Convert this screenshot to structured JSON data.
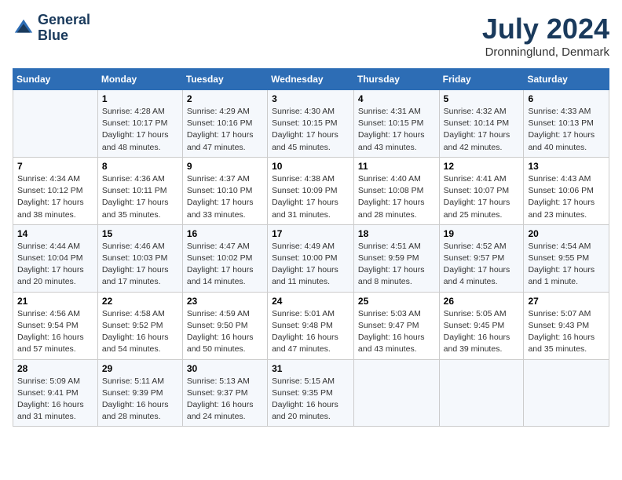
{
  "header": {
    "logo_line1": "General",
    "logo_line2": "Blue",
    "month_year": "July 2024",
    "location": "Dronninglund, Denmark"
  },
  "weekdays": [
    "Sunday",
    "Monday",
    "Tuesday",
    "Wednesday",
    "Thursday",
    "Friday",
    "Saturday"
  ],
  "weeks": [
    [
      {
        "day": "",
        "info": ""
      },
      {
        "day": "1",
        "info": "Sunrise: 4:28 AM\nSunset: 10:17 PM\nDaylight: 17 hours\nand 48 minutes."
      },
      {
        "day": "2",
        "info": "Sunrise: 4:29 AM\nSunset: 10:16 PM\nDaylight: 17 hours\nand 47 minutes."
      },
      {
        "day": "3",
        "info": "Sunrise: 4:30 AM\nSunset: 10:15 PM\nDaylight: 17 hours\nand 45 minutes."
      },
      {
        "day": "4",
        "info": "Sunrise: 4:31 AM\nSunset: 10:15 PM\nDaylight: 17 hours\nand 43 minutes."
      },
      {
        "day": "5",
        "info": "Sunrise: 4:32 AM\nSunset: 10:14 PM\nDaylight: 17 hours\nand 42 minutes."
      },
      {
        "day": "6",
        "info": "Sunrise: 4:33 AM\nSunset: 10:13 PM\nDaylight: 17 hours\nand 40 minutes."
      }
    ],
    [
      {
        "day": "7",
        "info": "Sunrise: 4:34 AM\nSunset: 10:12 PM\nDaylight: 17 hours\nand 38 minutes."
      },
      {
        "day": "8",
        "info": "Sunrise: 4:36 AM\nSunset: 10:11 PM\nDaylight: 17 hours\nand 35 minutes."
      },
      {
        "day": "9",
        "info": "Sunrise: 4:37 AM\nSunset: 10:10 PM\nDaylight: 17 hours\nand 33 minutes."
      },
      {
        "day": "10",
        "info": "Sunrise: 4:38 AM\nSunset: 10:09 PM\nDaylight: 17 hours\nand 31 minutes."
      },
      {
        "day": "11",
        "info": "Sunrise: 4:40 AM\nSunset: 10:08 PM\nDaylight: 17 hours\nand 28 minutes."
      },
      {
        "day": "12",
        "info": "Sunrise: 4:41 AM\nSunset: 10:07 PM\nDaylight: 17 hours\nand 25 minutes."
      },
      {
        "day": "13",
        "info": "Sunrise: 4:43 AM\nSunset: 10:06 PM\nDaylight: 17 hours\nand 23 minutes."
      }
    ],
    [
      {
        "day": "14",
        "info": "Sunrise: 4:44 AM\nSunset: 10:04 PM\nDaylight: 17 hours\nand 20 minutes."
      },
      {
        "day": "15",
        "info": "Sunrise: 4:46 AM\nSunset: 10:03 PM\nDaylight: 17 hours\nand 17 minutes."
      },
      {
        "day": "16",
        "info": "Sunrise: 4:47 AM\nSunset: 10:02 PM\nDaylight: 17 hours\nand 14 minutes."
      },
      {
        "day": "17",
        "info": "Sunrise: 4:49 AM\nSunset: 10:00 PM\nDaylight: 17 hours\nand 11 minutes."
      },
      {
        "day": "18",
        "info": "Sunrise: 4:51 AM\nSunset: 9:59 PM\nDaylight: 17 hours\nand 8 minutes."
      },
      {
        "day": "19",
        "info": "Sunrise: 4:52 AM\nSunset: 9:57 PM\nDaylight: 17 hours\nand 4 minutes."
      },
      {
        "day": "20",
        "info": "Sunrise: 4:54 AM\nSunset: 9:55 PM\nDaylight: 17 hours\nand 1 minute."
      }
    ],
    [
      {
        "day": "21",
        "info": "Sunrise: 4:56 AM\nSunset: 9:54 PM\nDaylight: 16 hours\nand 57 minutes."
      },
      {
        "day": "22",
        "info": "Sunrise: 4:58 AM\nSunset: 9:52 PM\nDaylight: 16 hours\nand 54 minutes."
      },
      {
        "day": "23",
        "info": "Sunrise: 4:59 AM\nSunset: 9:50 PM\nDaylight: 16 hours\nand 50 minutes."
      },
      {
        "day": "24",
        "info": "Sunrise: 5:01 AM\nSunset: 9:48 PM\nDaylight: 16 hours\nand 47 minutes."
      },
      {
        "day": "25",
        "info": "Sunrise: 5:03 AM\nSunset: 9:47 PM\nDaylight: 16 hours\nand 43 minutes."
      },
      {
        "day": "26",
        "info": "Sunrise: 5:05 AM\nSunset: 9:45 PM\nDaylight: 16 hours\nand 39 minutes."
      },
      {
        "day": "27",
        "info": "Sunrise: 5:07 AM\nSunset: 9:43 PM\nDaylight: 16 hours\nand 35 minutes."
      }
    ],
    [
      {
        "day": "28",
        "info": "Sunrise: 5:09 AM\nSunset: 9:41 PM\nDaylight: 16 hours\nand 31 minutes."
      },
      {
        "day": "29",
        "info": "Sunrise: 5:11 AM\nSunset: 9:39 PM\nDaylight: 16 hours\nand 28 minutes."
      },
      {
        "day": "30",
        "info": "Sunrise: 5:13 AM\nSunset: 9:37 PM\nDaylight: 16 hours\nand 24 minutes."
      },
      {
        "day": "31",
        "info": "Sunrise: 5:15 AM\nSunset: 9:35 PM\nDaylight: 16 hours\nand 20 minutes."
      },
      {
        "day": "",
        "info": ""
      },
      {
        "day": "",
        "info": ""
      },
      {
        "day": "",
        "info": ""
      }
    ]
  ]
}
